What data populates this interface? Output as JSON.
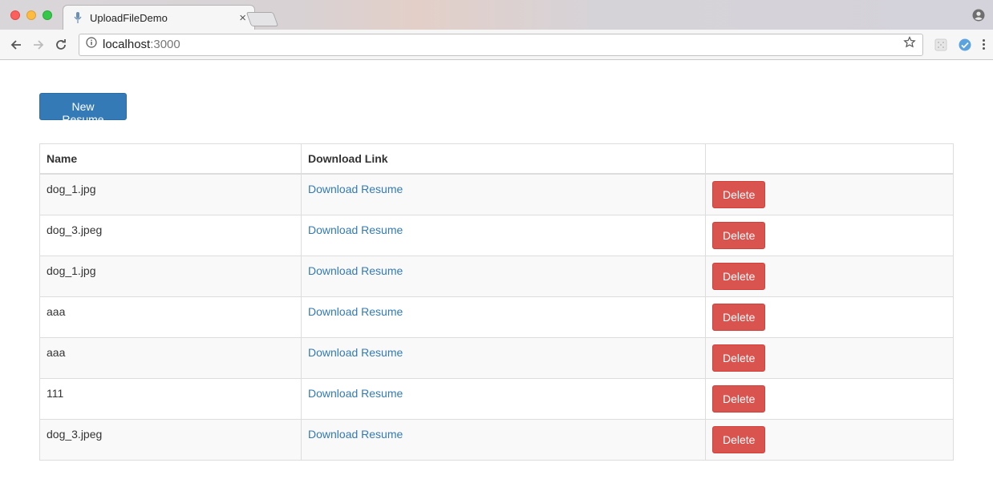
{
  "browser": {
    "tab_title": "UploadFileDemo",
    "tab_close": "×",
    "url_host": "localhost",
    "url_port": ":3000"
  },
  "icons": {
    "tab_favicon": "microphone-icon",
    "back": "back-arrow-icon",
    "forward": "forward-arrow-icon",
    "reload": "reload-icon",
    "info": "info-icon",
    "bookmark": "star-icon",
    "profile": "profile-icon",
    "extension1": "extension-icon",
    "extension2": "extension-icon",
    "menu": "kebab-menu-icon"
  },
  "colors": {
    "primary": "#337ab7",
    "danger": "#d9534f",
    "link": "#337ab7"
  },
  "page": {
    "new_button": "New Resume",
    "table": {
      "headers": [
        "Name",
        "Download Link",
        ""
      ],
      "rows": [
        {
          "name": "dog_1.jpg",
          "link": "Download Resume",
          "action": "Delete"
        },
        {
          "name": "dog_3.jpeg",
          "link": "Download Resume",
          "action": "Delete"
        },
        {
          "name": "dog_1.jpg",
          "link": "Download Resume",
          "action": "Delete"
        },
        {
          "name": "aaa",
          "link": "Download Resume",
          "action": "Delete"
        },
        {
          "name": "aaa",
          "link": "Download Resume",
          "action": "Delete"
        },
        {
          "name": "111",
          "link": "Download Resume",
          "action": "Delete"
        },
        {
          "name": "dog_3.jpeg",
          "link": "Download Resume",
          "action": "Delete"
        }
      ]
    }
  }
}
